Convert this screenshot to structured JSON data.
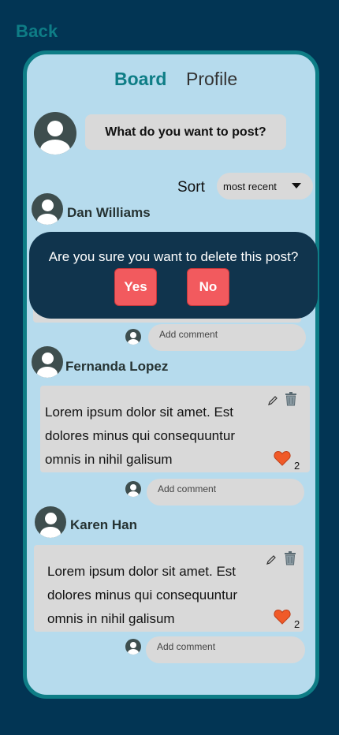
{
  "nav": {
    "back_label": "Back"
  },
  "tabs": [
    {
      "label": "Board",
      "active": true
    },
    {
      "label": "Profile",
      "active": false
    }
  ],
  "composer": {
    "placeholder": "What do you want to post?"
  },
  "sort": {
    "label": "Sort",
    "value": "most recent"
  },
  "posts": [
    {
      "author": "Dan Williams",
      "text": "",
      "likes": "",
      "comment_placeholder": "Add comment"
    },
    {
      "author": "Fernanda Lopez",
      "text": "Lorem ipsum dolor sit amet. Est dolores minus qui consequuntur omnis in nihil galisum",
      "likes": "2",
      "comment_placeholder": "Add comment"
    },
    {
      "author": "Karen Han",
      "text": "Lorem ipsum dolor sit amet. Est dolores minus qui consequuntur omnis in nihil galisum",
      "likes": "2",
      "comment_placeholder": "Add comment"
    }
  ],
  "delete_modal": {
    "message": "Are you sure you want to delete this post?",
    "yes_label": "Yes",
    "no_label": "No"
  },
  "colors": {
    "background": "#023554",
    "accent": "#0e7d86",
    "panel": "#b6dbed",
    "danger": "#f25a5e",
    "heart": "#f05a28"
  }
}
